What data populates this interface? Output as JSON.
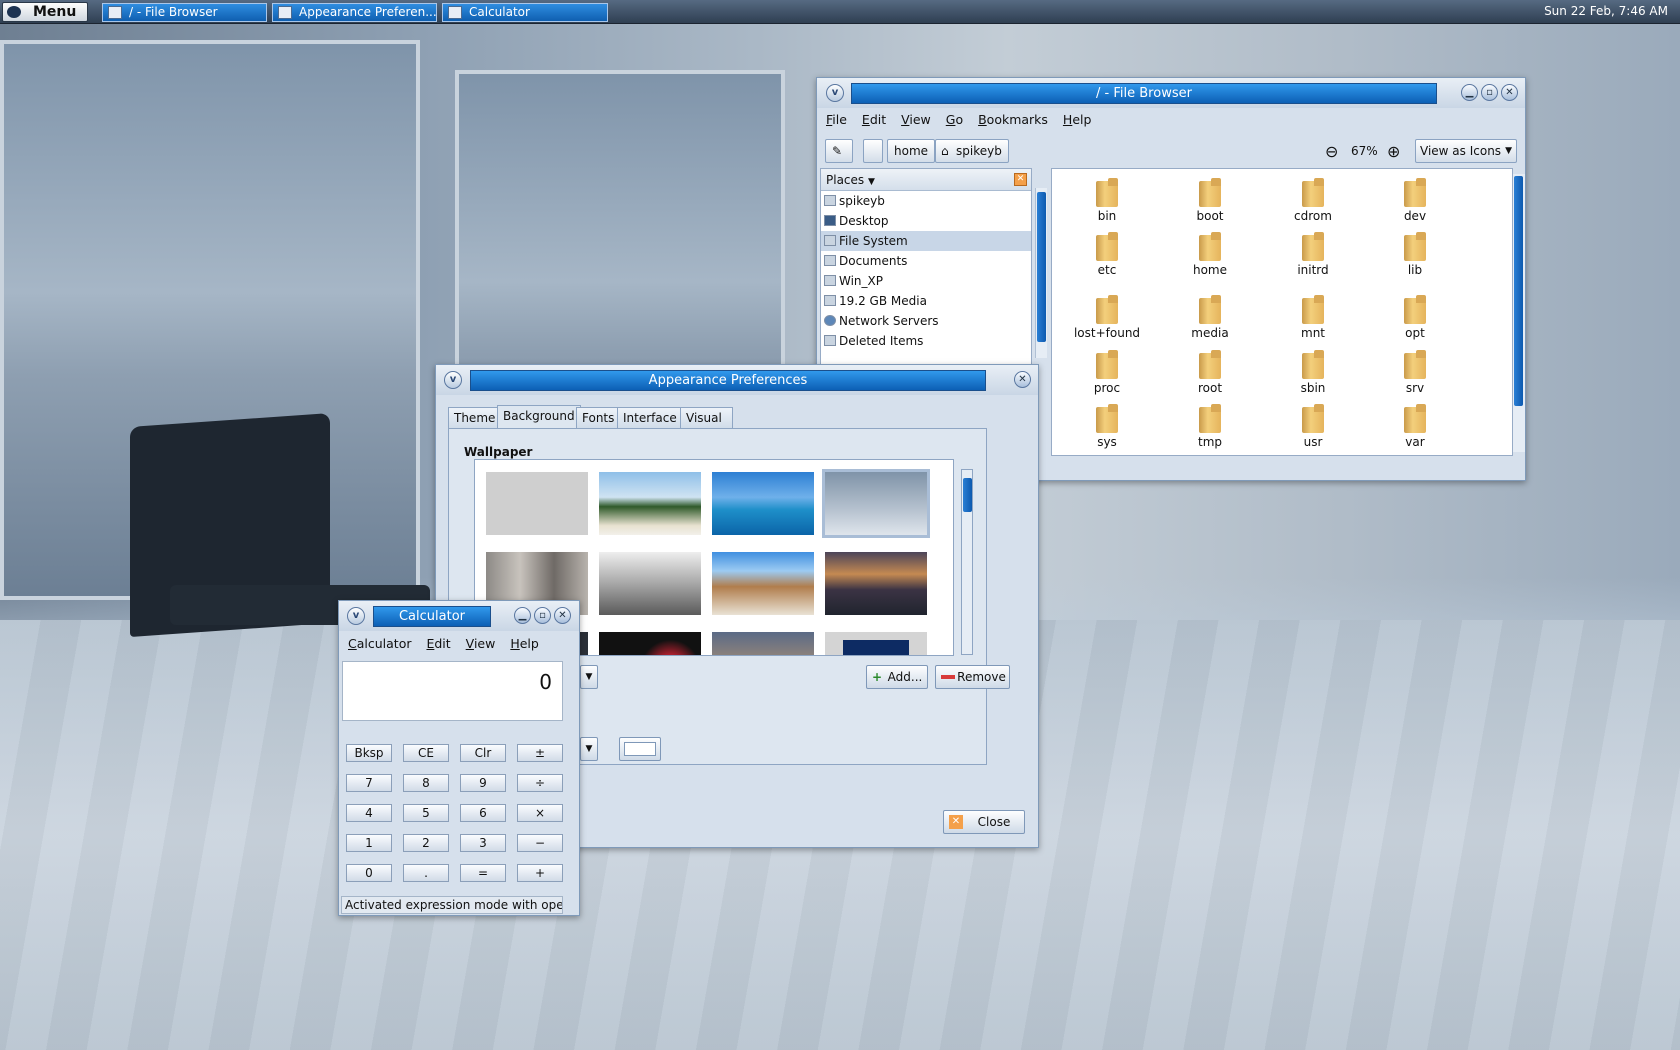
{
  "panel": {
    "menu_label": "Menu",
    "tasks": [
      {
        "label": "/ - File Browser"
      },
      {
        "label": "Appearance Preferen..."
      },
      {
        "label": "Calculator"
      }
    ],
    "clock": "Sun 22 Feb,  7:46 AM"
  },
  "file_browser": {
    "title": "/ - File Browser",
    "menu": [
      "File",
      "Edit",
      "View",
      "Go",
      "Bookmarks",
      "Help"
    ],
    "path_buttons": [
      "home",
      "spikeyb"
    ],
    "zoom": "67%",
    "view_mode": "View as Icons",
    "places_label": "Places",
    "places": [
      {
        "label": "spikeyb",
        "icon": "home-icon"
      },
      {
        "label": "Desktop",
        "icon": "desktop-icon"
      },
      {
        "label": "File System",
        "icon": "drive-icon",
        "selected": true
      },
      {
        "label": "Documents",
        "icon": "folder-icon"
      },
      {
        "label": "Win_XP",
        "icon": "drive-icon"
      },
      {
        "label": "19.2 GB Media",
        "icon": "drive-icon"
      },
      {
        "label": "Network Servers",
        "icon": "network-icon"
      },
      {
        "label": "Deleted Items",
        "icon": "trash-icon"
      }
    ],
    "folders": [
      "bin",
      "boot",
      "cdrom",
      "dev",
      "etc",
      "home",
      "initrd",
      "lib",
      "lost+found",
      "media",
      "mnt",
      "opt",
      "proc",
      "root",
      "sbin",
      "srv",
      "sys",
      "tmp",
      "usr",
      "var"
    ]
  },
  "appearance": {
    "title": "Appearance Preferences",
    "tabs": [
      "Theme",
      "Background",
      "Fonts",
      "Interface",
      "Visual Effects"
    ],
    "active_tab": "Background",
    "wallpaper_label": "Wallpaper",
    "add_label": "Add...",
    "remove_label": "Remove",
    "close_label": "Close"
  },
  "calculator": {
    "title": "Calculator",
    "menu": [
      "Calculator",
      "Edit",
      "View",
      "Help"
    ],
    "display": "0",
    "keys": [
      [
        "Bksp",
        "CE",
        "Clr",
        "±"
      ],
      [
        "7",
        "8",
        "9",
        "÷"
      ],
      [
        "4",
        "5",
        "6",
        "×"
      ],
      [
        "1",
        "2",
        "3",
        "−"
      ],
      [
        "0",
        ".",
        "=",
        "+"
      ]
    ],
    "status": "Activated expression mode with operat..."
  },
  "colors": {
    "titlebar_accent": "#0c5fb5",
    "window_bg": "#d6e0ec"
  }
}
